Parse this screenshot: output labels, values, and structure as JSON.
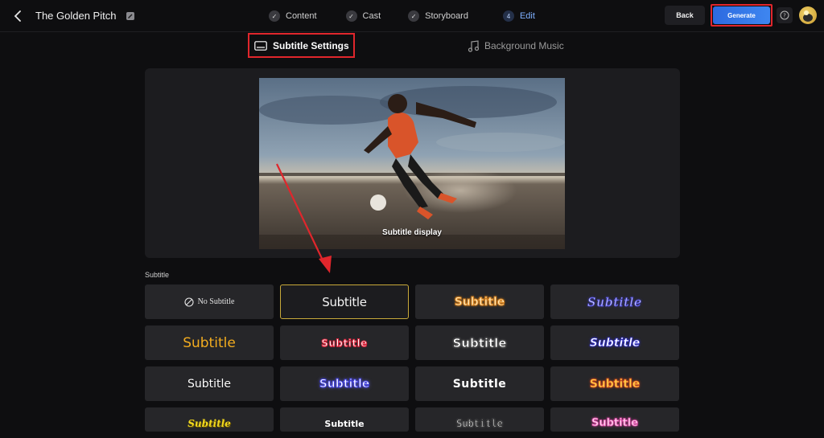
{
  "header": {
    "project_title": "The Golden Pitch",
    "steps": [
      {
        "label": "Content",
        "marker": "✓"
      },
      {
        "label": "Cast",
        "marker": "✓"
      },
      {
        "label": "Storyboard",
        "marker": "✓"
      },
      {
        "label": "Edit",
        "marker": "4"
      }
    ],
    "active_step": "Edit",
    "back_label": "Back",
    "generate_label": "Generate"
  },
  "tabs": {
    "subtitle_settings": "Subtitle Settings",
    "background_music": "Background Music",
    "active": "Subtitle Settings"
  },
  "preview": {
    "caption": "Subtitle display"
  },
  "subtitle_section": {
    "label": "Subtitle",
    "selected_index": 1,
    "styles": [
      "No Subtitle",
      "Subtitle",
      "Subtitle",
      "Subtitle",
      "Subtitle",
      "Subtitle",
      "Subtitle",
      "Subtitle",
      "Subtitle",
      "Subtitle",
      "Subtitle",
      "Subtitle",
      "Subtitle",
      "Subtitle",
      "Subtitle",
      "Subtitle"
    ]
  },
  "colors": {
    "highlight_red": "#e0262c",
    "accent_blue": "#3e86f0",
    "selected_border": "#c8a93a"
  }
}
